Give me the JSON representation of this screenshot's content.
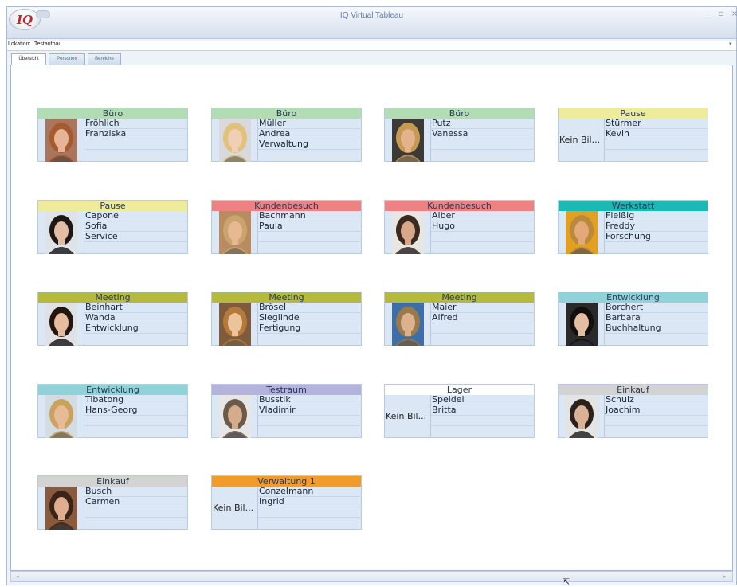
{
  "app": {
    "title": "IQ Virtual Tableau",
    "logo": "IQ"
  },
  "window_controls": {
    "minimize": "–",
    "maximize": "▫",
    "close": "×"
  },
  "location": {
    "label": "Lokation:",
    "value": "Testaufbau",
    "dropdown_icon": "▾"
  },
  "tabs": [
    {
      "label": "Übersicht"
    },
    {
      "label": "Personen"
    },
    {
      "label": "Bereiche"
    }
  ],
  "scroll": {
    "left_icon": "◂",
    "right_icon": "▸"
  },
  "cards": [
    {
      "area": "Büro",
      "area_color": "#b2dcb4",
      "photo": true,
      "hair_color": "#a55a2f",
      "skin_color": "#e6b597",
      "bg_color": "#a9765d",
      "lines": [
        "Fröhlich",
        "Franziska",
        "",
        ""
      ]
    },
    {
      "area": "Büro",
      "area_color": "#b2dcb4",
      "photo": true,
      "hair_color": "#e0c27c",
      "skin_color": "#f1cfb4",
      "bg_color": "#d7d9dd",
      "lines": [
        "Müller",
        "Andrea",
        "Verwaltung",
        ""
      ]
    },
    {
      "area": "Büro",
      "area_color": "#b2dcb4",
      "photo": true,
      "hair_color": "#c79a52",
      "skin_color": "#e2b38d",
      "bg_color": "#3c3a36",
      "lines": [
        "Putz",
        "Vanessa",
        "",
        ""
      ]
    },
    {
      "area": "Pause",
      "area_color": "#eeec9a",
      "photo": false,
      "nophoto": "Kein Bil...",
      "lines": [
        "Stürmer",
        "Kevin",
        "",
        ""
      ]
    },
    {
      "area": "Pause",
      "area_color": "#eeec9a",
      "photo": true,
      "hair_color": "#1d1815",
      "skin_color": "#e3bca5",
      "bg_color": "#dfe2e6",
      "lines": [
        "Capone",
        "Sofia",
        "Service",
        ""
      ]
    },
    {
      "area": "Kundenbesuch",
      "area_color": "#ee8282",
      "photo": true,
      "hair_color": "#caa46c",
      "skin_color": "#e7b894",
      "bg_color": "#b88c60",
      "lines": [
        "Bachmann",
        "Paula",
        "",
        ""
      ]
    },
    {
      "area": "Kundenbesuch",
      "area_color": "#ee8282",
      "photo": true,
      "hair_color": "#3b2a1f",
      "skin_color": "#d9a88a",
      "bg_color": "#e8e6e2",
      "lines": [
        "Alber",
        "Hugo",
        "",
        ""
      ]
    },
    {
      "area": "Werkstatt",
      "area_color": "#1ab9b4",
      "photo": true,
      "hair_color": "#b98a3d",
      "skin_color": "#e5a878",
      "bg_color": "#e2a020",
      "lines": [
        "Fleißig",
        "Freddy",
        "Forschung",
        ""
      ]
    },
    {
      "area": "Meeting",
      "area_color": "#b5b93c",
      "photo": true,
      "hair_color": "#22160f",
      "skin_color": "#e7bb9d",
      "bg_color": "#dfe1e4",
      "lines": [
        "Beinhart",
        "Wanda",
        "Entwicklung",
        ""
      ]
    },
    {
      "area": "Meeting",
      "area_color": "#b5b93c",
      "photo": true,
      "hair_color": "#b57a3b",
      "skin_color": "#ecc49c",
      "bg_color": "#7e5b3c",
      "lines": [
        "Brösel",
        "Sieglinde",
        "Fertigung",
        ""
      ]
    },
    {
      "area": "Meeting",
      "area_color": "#b5b93c",
      "photo": true,
      "hair_color": "#9a7a4a",
      "skin_color": "#dcb18d",
      "bg_color": "#3e6ea8",
      "lines": [
        "Maier",
        "Alfred",
        "",
        ""
      ]
    },
    {
      "area": "Entwicklung",
      "area_color": "#8fd2d8",
      "photo": true,
      "hair_color": "#140f0d",
      "skin_color": "#e4bea3",
      "bg_color": "#2a2a2a",
      "lines": [
        "Borchert",
        "Barbara",
        "Buchhaltung",
        ""
      ]
    },
    {
      "area": "Entwicklung",
      "area_color": "#8fd2d8",
      "photo": true,
      "hair_color": "#c9a25c",
      "skin_color": "#e7bb98",
      "bg_color": "#d4dce3",
      "lines": [
        "Tibatong",
        "Hans-Georg",
        "",
        ""
      ]
    },
    {
      "area": "Testraum",
      "area_color": "#b3b3de",
      "photo": true,
      "hair_color": "#6b5a4a",
      "skin_color": "#d6ab8c",
      "bg_color": "#e6e6e6",
      "lines": [
        "Busstik",
        "Vladimir",
        "",
        ""
      ]
    },
    {
      "area": "Lager",
      "area_color": "#ffffff",
      "photo": false,
      "nophoto": "Kein Bil...",
      "lines": [
        "Speidel",
        "Britta",
        "",
        ""
      ]
    },
    {
      "area": "Einkauf",
      "area_color": "#d3d3d3",
      "photo": true,
      "hair_color": "#2c211a",
      "skin_color": "#dab196",
      "bg_color": "#e4e4e4",
      "lines": [
        "Schulz",
        "Joachim",
        "",
        ""
      ]
    },
    {
      "area": "Einkauf",
      "area_color": "#d3d3d3",
      "photo": true,
      "hair_color": "#3a2418",
      "skin_color": "#dfae8e",
      "bg_color": "#8b5a3c",
      "lines": [
        "Busch",
        "Carmen",
        "",
        ""
      ]
    },
    {
      "area": "Verwaltung 1",
      "area_color": "#f39a2c",
      "photo": false,
      "nophoto": "Kein Bil...",
      "lines": [
        "Conzelmann",
        "Ingrid",
        "",
        ""
      ]
    }
  ]
}
